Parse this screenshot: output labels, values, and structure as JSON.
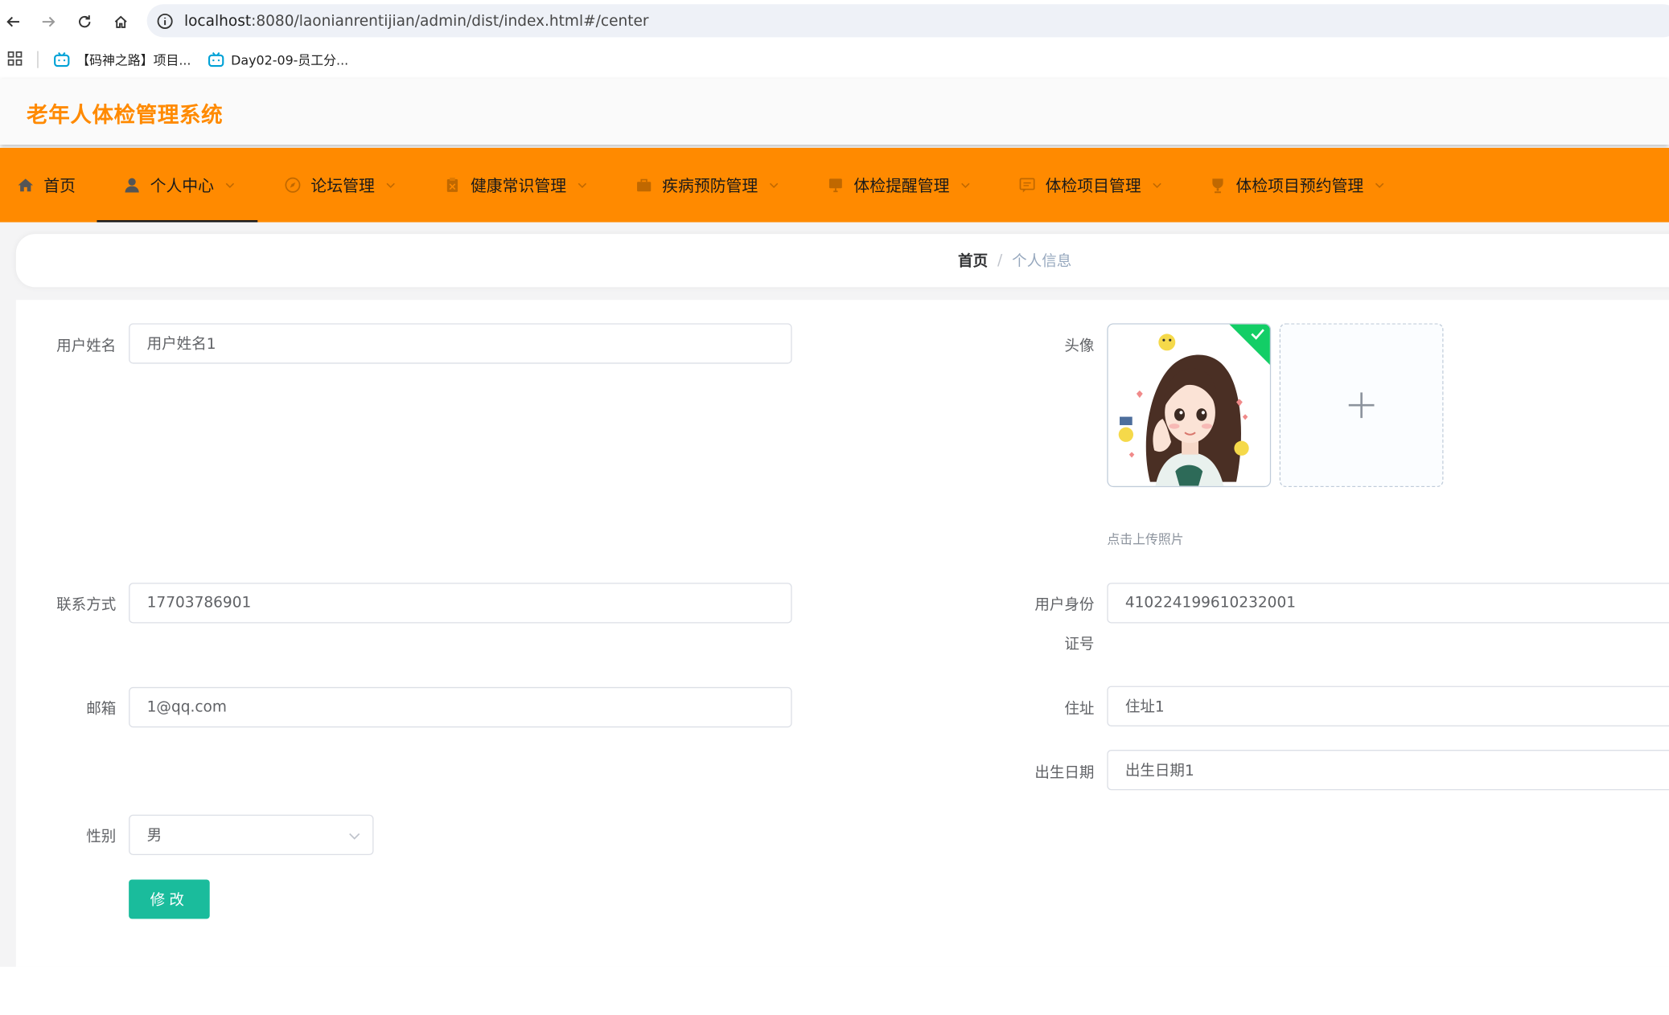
{
  "browser": {
    "url_host": "localhost",
    "url_rest": ":8080/laonianrentijian/admin/dist/index.html#/center",
    "bookmarks": [
      {
        "label": "【码神之路】项目..."
      },
      {
        "label": "Day02-09-员工分..."
      }
    ]
  },
  "app": {
    "title": "老年人体检管理系统"
  },
  "nav": {
    "items": [
      {
        "label": "首页",
        "icon": "home-icon"
      },
      {
        "label": "个人中心",
        "icon": "user-icon"
      },
      {
        "label": "论坛管理",
        "icon": "compass-icon"
      },
      {
        "label": "健康常识管理",
        "icon": "clipboard-icon"
      },
      {
        "label": "疾病预防管理",
        "icon": "briefcase-icon"
      },
      {
        "label": "体检提醒管理",
        "icon": "monitor-icon"
      },
      {
        "label": "体检项目管理",
        "icon": "chat-icon"
      },
      {
        "label": "体检项目预约管理",
        "icon": "trophy-icon"
      }
    ],
    "active_index": 1
  },
  "breadcrumb": {
    "home": "首页",
    "separator": "/",
    "current": "个人信息"
  },
  "form": {
    "username_label": "用户姓名",
    "username_value": "用户姓名1",
    "avatar_label": "头像",
    "upload_tip": "点击上传照片",
    "phone_label": "联系方式",
    "phone_value": "17703786901",
    "idcard_label_line1": "用户身份",
    "idcard_label_line2": "证号",
    "idcard_value": "410224199610232001",
    "email_label": "邮箱",
    "email_value": "1@qq.com",
    "address_label": "住址",
    "address_value": "住址1",
    "birthday_label": "出生日期",
    "birthday_value": "出生日期1",
    "gender_label": "性别",
    "gender_value": "男",
    "submit_label": "修改"
  },
  "colors": {
    "brand_orange": "#ff8a00",
    "submit_green": "#1abc9c",
    "upload_success": "#13ce66"
  }
}
